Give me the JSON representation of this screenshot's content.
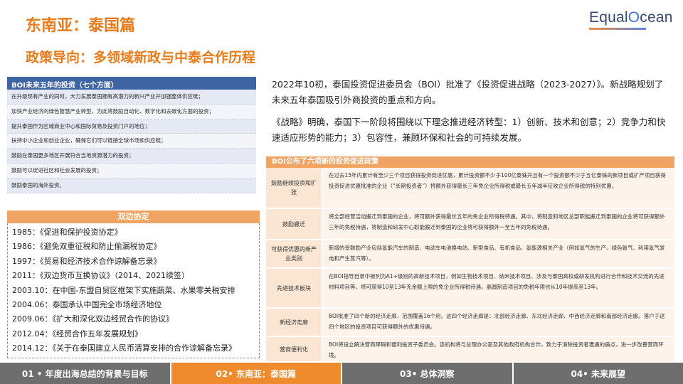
{
  "header": {
    "title": "东南亚：泰国篇",
    "subtitle": "政策导向：多领域新政与中泰合作历程",
    "logo": {
      "part1": "Equal",
      "part2": "O",
      "part3": "cean"
    }
  },
  "boi_panel": {
    "title": "BOI未来五年的投资（七个方面）",
    "items": [
      "在升级现有产业的同时，大力发展泰国拥有高潜力的新兴产业并加强整体供应链；",
      "加快产业经济向绿色智慧产业转型，为此将鼓励自动化、数字化和去碳化方面的投资；",
      "提升泰国作为区域商业中心和国际贸易及投资门户的地位；",
      "扶持中小企业和创业企业，确保它们可以链接全球市场和供应链；",
      "鼓励在泰国更多地区开展符合当地资源潜力的投资；",
      "鼓励可以促进社区和社会发展的投资；",
      "鼓励泰国的海外投资。"
    ]
  },
  "bilateral_panel": {
    "title": "双边协定",
    "items": [
      "1985：《促进和保护投资协定》",
      "1986：《避免双重征税和防止偷漏税协定》",
      "1997：《贸易和经济技术合作谅解备忘录》",
      "2011：《双边货币互换协议》（2014、2021续签）",
      "2003.10：在中国-东盟自贸区框架下实施蔬菜、水果零关税安排",
      "2004.06：泰国承认中国完全市场经济地位",
      "2009.06：《扩大和深化双边经贸合作的协议》",
      "2012.04：《经贸合作五年发展规划》",
      "2014.12：《关于在泰国建立人民币清算安排的合作谅解备忘录》"
    ]
  },
  "intro": {
    "p1": "2022年10初，泰国投资促进委员会（BOI）批准了《投资促进战略（2023-2027）》。新战略规划了未来五年泰国吸引外商投资的重点和方向。",
    "p2": "《战略》明确，泰国下一阶段将围绕以下理念推进经济转型：1）创新、技术和创意；2）竞争力和快速适应形势的能力；3）包容性，兼顾环保和社会的可持续发展。"
  },
  "policy_table": {
    "title": "BOI公布了六项新的投资促进政策",
    "rows": [
      {
        "category": "鼓励继续投资和扩张",
        "description": "在过去15年内累计有至少三个项目获得投资促进优惠，累计投资额不少于100亿泰铢并且有一个投资额不少于五亿泰铢的新项目或扩产项目获得投资促进优惠批准的企业（“长期投资者”）将额外获得最长三年免企业所得税或最长五年减半征收企业所得税的特别优惠。"
      },
      {
        "category": "鼓励搬迁",
        "description": "将全部经营活动搬迁到泰国的企业，将可额外获得最长五年的免企业所得税待遇。其中，将制造和地区总部职能搬迁到泰国的企业将可获得额外三年的免税待遇，将制造和研发中心职能搬迁到泰国的企业将可获得额外一至五年的免税待遇。"
      },
      {
        "category": "可获得优惠的新产业类别",
        "description": "新增的受鼓励产业包括氢能汽车的制造、电动车电池换电站、新型食品、有机食品、氢能源相关产业（例如氢气的生产、绿色氨气、利用氢气发电和产生蒸汽等）。"
      },
      {
        "category": "先进技术板块",
        "description": "在BOI指导目录中被列为A1+级别的高新技术项目，例如生物技术项目、纳米技术项目、涉及与泰国高校或研发机构进行合作和技术交流的先进材料项目等，将可获得10至13年无金额上限的免企业所得税待遇，晶圆制造项目的免税年限也从10年提高至13年。"
      },
      {
        "category": "新经济走廊",
        "description": "BOI批准了四个新的经济走廊，范围覆盖16个府。这四个经济走廊是：北部经济走廊、东北经济走廊、中西经济走廊和南部经济走廊。落户于这四个地区的投资项目可获得额外的优惠待遇。"
      },
      {
        "category": "营商便利化",
        "description": "BOI将设立解决营商障碍和便利投资子委员会。该机构将与总理办公室及其他政府机构合作，致力于消除投资者遭遇的痛点，进一步改善营商环境。"
      }
    ]
  },
  "footer": {
    "tabs": [
      {
        "label": "01 • 年度出海总结的背景与目标"
      },
      {
        "label": "02• 东南亚：泰国篇"
      },
      {
        "label": "03• 总体洞察"
      },
      {
        "label": "04• 未来展望"
      }
    ]
  },
  "colors": {
    "accent_orange": "#e87b1a",
    "boi_header_blue": "#3f64a5",
    "panel_header_orange": "#f0a463",
    "footer_gray": "#6e6e6e",
    "footer_active": "#ef8b2c"
  }
}
